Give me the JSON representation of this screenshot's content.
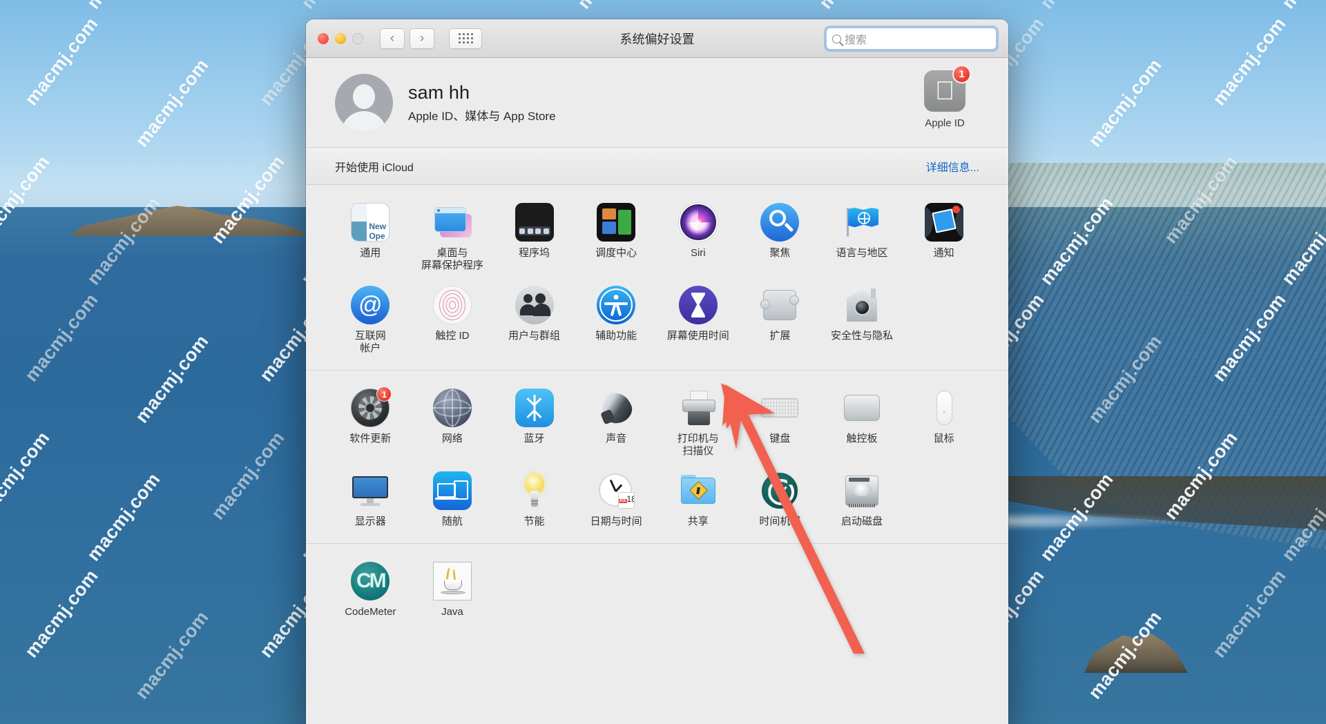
{
  "desktop": {
    "watermark_text": "macmj.com"
  },
  "window": {
    "title": "系统偏好设置",
    "traffic_lights": {
      "close": "close-button",
      "minimize": "minimize-button",
      "zoom": "zoom-button"
    },
    "nav": {
      "back": "‹",
      "forward": "›",
      "grid": "show-all-grid"
    },
    "search": {
      "placeholder": "搜索",
      "value": ""
    }
  },
  "account": {
    "name": "sam hh",
    "subtitle": "Apple ID、媒体与 App Store",
    "apple_id": {
      "label": "Apple ID",
      "badge": "1"
    }
  },
  "icloud": {
    "text": "开始使用 iCloud",
    "link": "详细信息..."
  },
  "sections": [
    {
      "id": "personal",
      "items": [
        {
          "icon": "general-icon",
          "label": "通用",
          "art": "general"
        },
        {
          "icon": "desktop-screensaver-icon",
          "label": "桌面与\n屏幕保护程序",
          "art": "desktop"
        },
        {
          "icon": "dock-icon",
          "label": "程序坞",
          "art": "dock"
        },
        {
          "icon": "mission-control-icon",
          "label": "调度中心",
          "art": "mission"
        },
        {
          "icon": "siri-icon",
          "label": "Siri",
          "art": "siri"
        },
        {
          "icon": "spotlight-icon",
          "label": "聚焦",
          "art": "spotlight"
        },
        {
          "icon": "language-region-icon",
          "label": "语言与地区",
          "art": "lang"
        },
        {
          "icon": "notifications-icon",
          "label": "通知",
          "art": "notif"
        },
        {
          "icon": "internet-accounts-icon",
          "label": "互联网\n帐户",
          "art": "internet"
        },
        {
          "icon": "touch-id-icon",
          "label": "触控 ID",
          "art": "touchid"
        },
        {
          "icon": "users-groups-icon",
          "label": "用户与群组",
          "art": "users"
        },
        {
          "icon": "accessibility-icon",
          "label": "辅助功能",
          "art": "access"
        },
        {
          "icon": "screen-time-icon",
          "label": "屏幕使用时间",
          "art": "screentime"
        },
        {
          "icon": "extensions-icon",
          "label": "扩展",
          "art": "ext"
        },
        {
          "icon": "security-privacy-icon",
          "label": "安全性与隐私",
          "art": "security"
        }
      ]
    },
    {
      "id": "hardware",
      "items": [
        {
          "icon": "software-update-icon",
          "label": "软件更新",
          "art": "swupd",
          "badge": "1"
        },
        {
          "icon": "network-icon",
          "label": "网络",
          "art": "network"
        },
        {
          "icon": "bluetooth-icon",
          "label": "蓝牙",
          "art": "bt"
        },
        {
          "icon": "sound-icon",
          "label": "声音",
          "art": "sound"
        },
        {
          "icon": "printers-scanners-icon",
          "label": "打印机与\n扫描仪",
          "art": "printer"
        },
        {
          "icon": "keyboard-icon",
          "label": "键盘",
          "art": "keyboard"
        },
        {
          "icon": "trackpad-icon",
          "label": "触控板",
          "art": "trackpad"
        },
        {
          "icon": "mouse-icon",
          "label": "鼠标",
          "art": "mouse"
        },
        {
          "icon": "displays-icon",
          "label": "显示器",
          "art": "display"
        },
        {
          "icon": "sidecar-icon",
          "label": "随航",
          "art": "sidecar"
        },
        {
          "icon": "energy-saver-icon",
          "label": "节能",
          "art": "energy"
        },
        {
          "icon": "date-time-icon",
          "label": "日期与时间",
          "art": "datetime",
          "cal_month": "JUL",
          "cal_day": "18"
        },
        {
          "icon": "sharing-icon",
          "label": "共享",
          "art": "sharing"
        },
        {
          "icon": "time-machine-icon",
          "label": "时间机器",
          "art": "tm"
        },
        {
          "icon": "startup-disk-icon",
          "label": "启动磁盘",
          "art": "startup"
        }
      ]
    },
    {
      "id": "third-party",
      "items": [
        {
          "icon": "codemeter-icon",
          "label": "CodeMeter",
          "art": "codemeter"
        },
        {
          "icon": "java-icon",
          "label": "Java",
          "art": "java"
        }
      ]
    }
  ],
  "annotation": {
    "arrow_color": "#f2604f",
    "points_to": "安全性与隐私"
  },
  "colors": {
    "accent_link": "#1165c5",
    "badge_red": "#e8392c",
    "window_bg": "#ececec",
    "arrow_red": "#f2604f"
  }
}
